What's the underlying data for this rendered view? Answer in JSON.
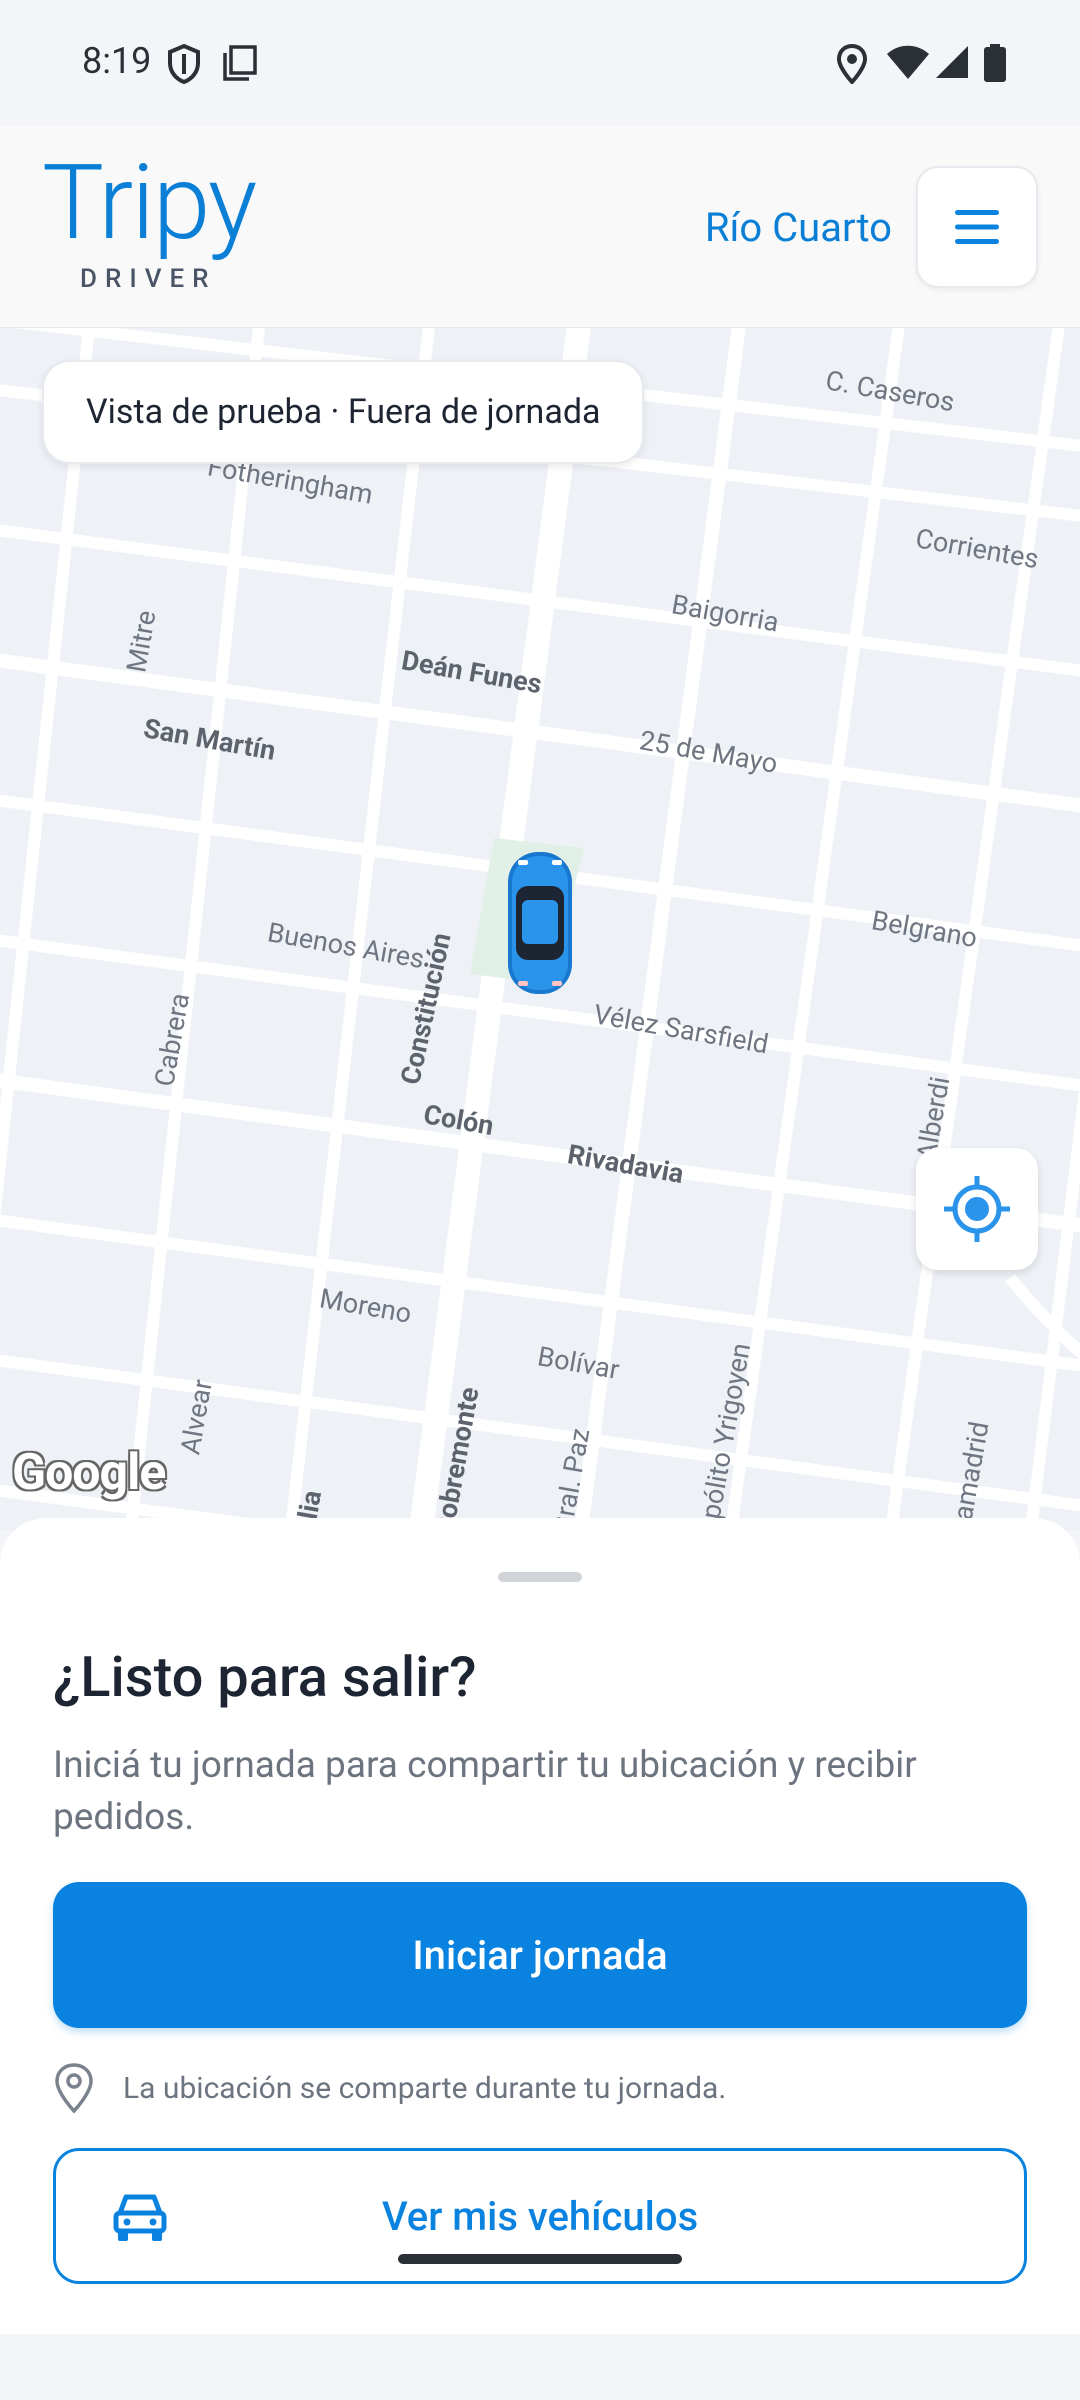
{
  "status_bar": {
    "time": "8:19"
  },
  "header": {
    "logo_text": "Tripy",
    "logo_subtitle": "DRIVER",
    "city": "Río Cuarto"
  },
  "map": {
    "test_pill": "Vista de prueba · Fuera de jornada",
    "attribution": "Google",
    "streets": [
      "C. Caseros",
      "Fotheringham",
      "Corrientes",
      "Baigorria",
      "Mitre",
      "Deán Funes",
      "San Martín",
      "25 de Mayo",
      "Buenos Aires",
      "Constitución",
      "Belgrano",
      "Cabrera",
      "Vélez Sarsfield",
      "Colón",
      "Rivadavia",
      "Alberdi",
      "Moreno",
      "Bolívar",
      "Alvear",
      "Sobremonte",
      "Gral. Paz",
      "Hipólito Yrigoyen",
      "Lamadrid",
      "Italia"
    ]
  },
  "sheet": {
    "title": "¿Listo para salir?",
    "description": "Iniciá tu jornada para compartir tu ubicación y recibir pedidos.",
    "primary_button": "Iniciar jornada",
    "location_note": "La ubicación se comparte durante tu jornada.",
    "secondary_button": "Ver mis vehículos"
  },
  "colors": {
    "brand": "#0a83e0",
    "text": "#1d2533",
    "muted": "#6c7480"
  }
}
